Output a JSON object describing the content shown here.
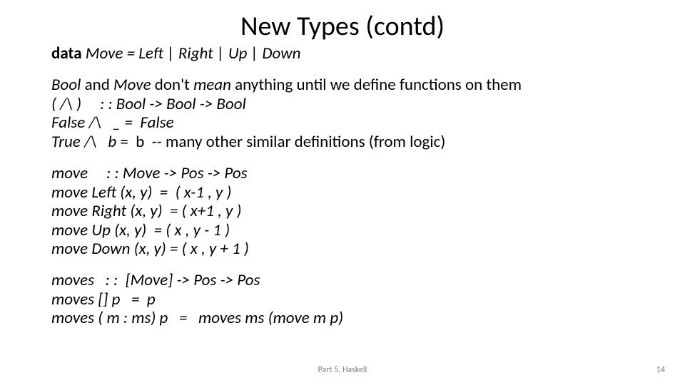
{
  "title": "New Types (contd)",
  "decl_data": "data",
  "decl_rest": " Move = Left | Right | Up | Down",
  "p1_bool": "Bool",
  "p1_and": " and ",
  "p1_move": "Move",
  "p1_dont": " don't ",
  "p1_mean": "mean",
  "p1_rest": " anything until we define functions on them",
  "l_andop": "( /\\ )     : : Bool -> Bool -> Bool",
  "l_false": "False /\\   _ =  False",
  "l_true1": "True /\\   b",
  "l_true2": " =  b  -- many other similar definitions (from logic)",
  "mv_sig": "move     : : Move -> Pos -> Pos",
  "mv_left": "move Left (x, y)  =  ( x-1 , y )",
  "mv_right": "move Right (x, y)  = ( x+1 , y )",
  "mv_up": "move Up (x, y)  = ( x , y - 1 )",
  "mv_down": "move Down (x, y) = ( x , y + 1 )",
  "ms_sig": "moves   : :  [Move] -> Pos -> Pos",
  "ms_nil": "moves [] p   =  p",
  "ms_cons": "moves ( m : ms) p   =   moves ms (move m p)",
  "footer_center": "Part 5, Haskell",
  "footer_right": "14"
}
